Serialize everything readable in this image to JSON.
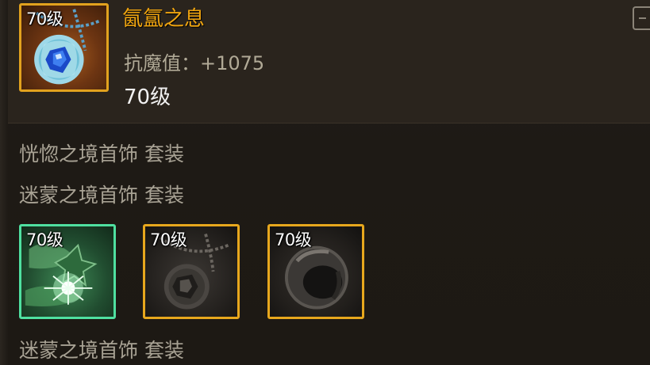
{
  "tooltip": {
    "item_level_badge": "70级",
    "item_name": "氤氲之息",
    "stat_line": "抗魔值：+1075",
    "level_line": "70级",
    "set_lines": [
      "恍惚之境首饰 套装",
      "迷蒙之境首饰 套装",
      "迷蒙之境首饰 套装"
    ],
    "set_items": [
      {
        "level": "70级",
        "icon": "glowing-leaf-item-icon"
      },
      {
        "level": "70级",
        "icon": "locked-necklace-item-icon"
      },
      {
        "level": "70级",
        "icon": "locked-ring-item-icon"
      }
    ]
  },
  "colors": {
    "item_name": "#f0a50f",
    "stat": "#b0a996",
    "legendary_border": "#e2a21e",
    "set_item1_border": "#4fe0a0"
  },
  "icons": {
    "main_item": "sapphire-necklace-icon",
    "corner": "collapse-tab-icon"
  }
}
